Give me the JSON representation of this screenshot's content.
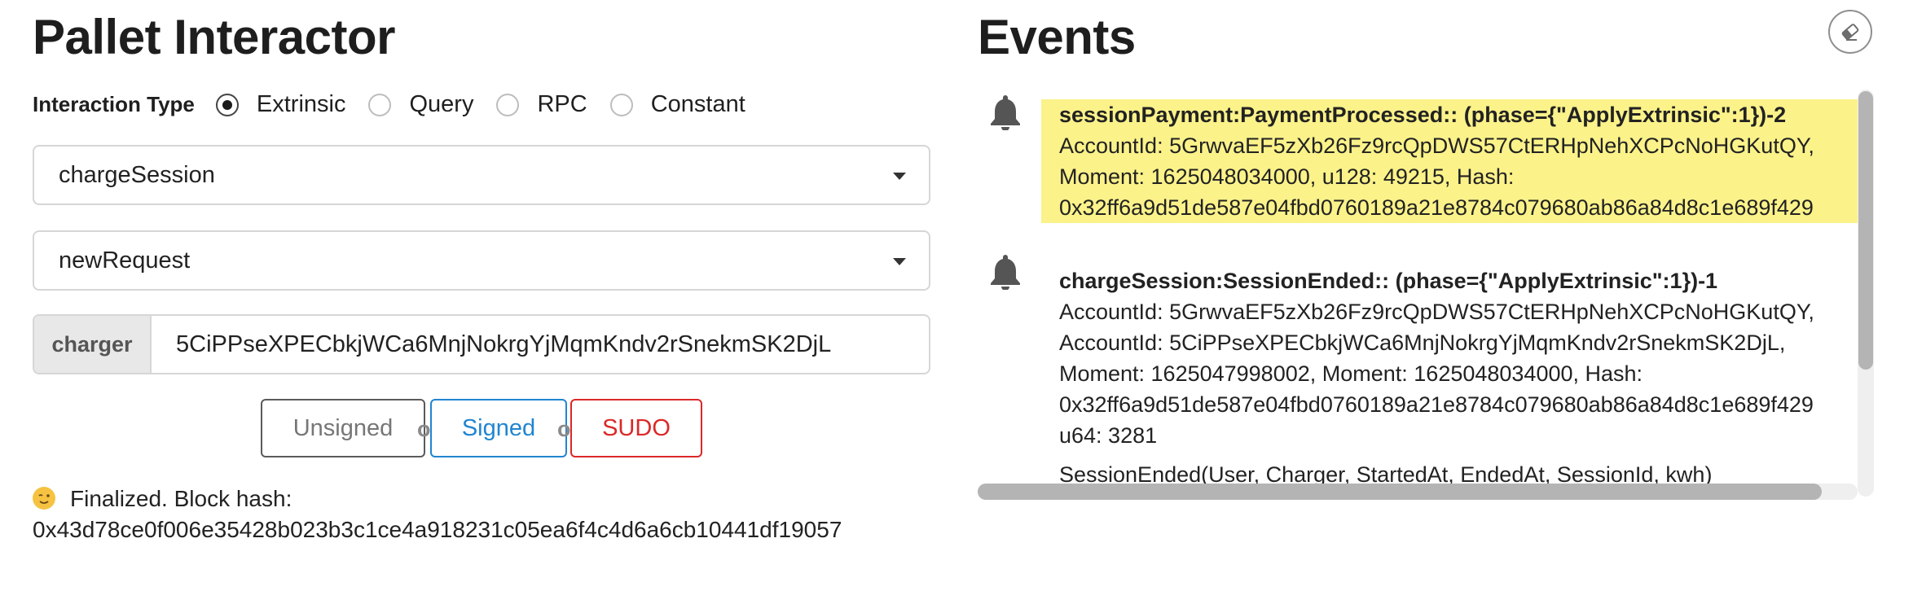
{
  "left": {
    "title": "Pallet Interactor",
    "interaction_label": "Interaction Type",
    "radio_options": [
      {
        "label": "Extrinsic",
        "checked": true
      },
      {
        "label": "Query",
        "checked": false
      },
      {
        "label": "RPC",
        "checked": false
      },
      {
        "label": "Constant",
        "checked": false
      }
    ],
    "pallet_select": "chargeSession",
    "callable_select": "newRequest",
    "param_label": "charger",
    "param_value": "5CiPPseXPECbkjWCa6MnjNokrgYjMqmKndv2rSnekmSK2DjL",
    "buttons": {
      "unsigned": "Unsigned",
      "or": "or",
      "signed": "Signed",
      "sudo": "SUDO"
    },
    "status_text": "Finalized. Block hash:",
    "block_hash": "0x43d78ce0f006e35428b023b3c1ce4a918231c05ea6f4c4d6a6cb10441df19057"
  },
  "right": {
    "title": "Events",
    "events": [
      {
        "header": "sessionPayment:PaymentProcessed:: (phase={\"ApplyExtrinsic\":1})-2",
        "lines": [
          "AccountId: 5GrwvaEF5zXb26Fz9rcQpDWS57CtERHpNehXCPcNoHGKutQY,",
          "Moment: 1625048034000, u128: 49215, Hash:",
          "0x32ff6a9d51de587e04fbd0760189a21e8784c079680ab86a84d8c1e689f429"
        ],
        "highlighted": true
      },
      {
        "header": "chargeSession:SessionEnded:: (phase={\"ApplyExtrinsic\":1})-1",
        "lines": [
          "AccountId: 5GrwvaEF5zXb26Fz9rcQpDWS57CtERHpNehXCPcNoHGKutQY,",
          "AccountId: 5CiPPseXPECbkjWCa6MnjNokrgYjMqmKndv2rSnekmSK2DjL,",
          "Moment: 1625047998002, Moment: 1625048034000, Hash:",
          "0x32ff6a9d51de587e04fbd0760189a21e8784c079680ab86a84d8c1e689f429",
          "u64: 3281"
        ],
        "footer": "SessionEnded(User, Charger, StartedAt, EndedAt, SessionId, kwh)",
        "highlighted": false
      }
    ]
  },
  "colors": {
    "signed": "#2185d0",
    "sudo": "#db2828",
    "highlight": "#fbf28a"
  },
  "icons": {
    "event": "bell-icon",
    "clear": "eraser-icon",
    "status": "winking-face-emoji"
  }
}
